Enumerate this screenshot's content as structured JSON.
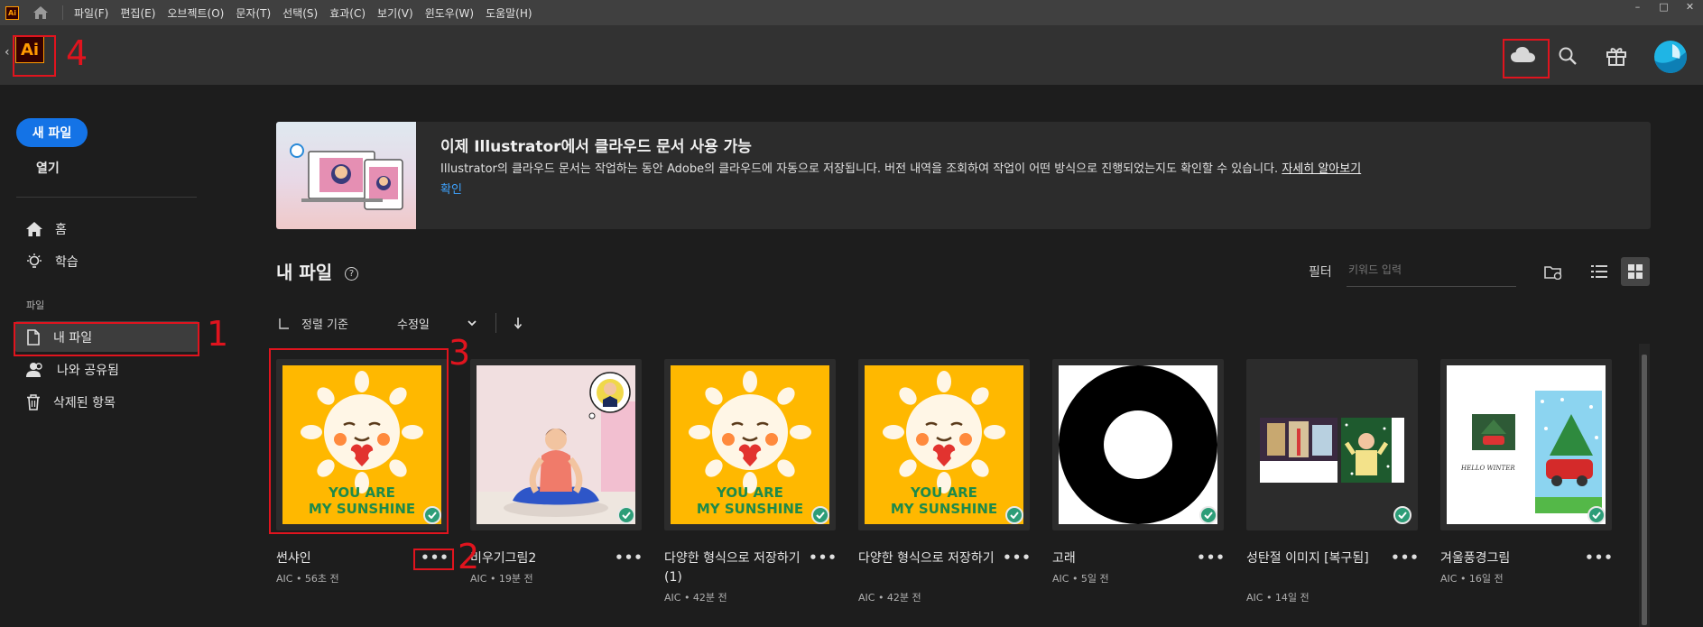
{
  "app": {
    "short_icon_label": "Ai",
    "logo_label": "Ai"
  },
  "menubar": {
    "items": [
      "파일(F)",
      "편집(E)",
      "오브젝트(O)",
      "문자(T)",
      "선택(S)",
      "효과(C)",
      "보기(V)",
      "윈도우(W)",
      "도움말(H)"
    ]
  },
  "window_controls": {
    "minimize": "–",
    "maximize": "□",
    "close": "✕"
  },
  "header": {
    "icons": [
      "cloud-icon",
      "search-icon",
      "gift-icon",
      "avatar"
    ]
  },
  "sidebar": {
    "new_file": "새 파일",
    "open": "열기",
    "nav": [
      {
        "label": "홈",
        "icon": "home-icon"
      },
      {
        "label": "학습",
        "icon": "lightbulb-icon"
      }
    ],
    "section_label": "파일",
    "files_nav": [
      {
        "label": "내 파일",
        "icon": "document-icon"
      },
      {
        "label": "나와 공유됨",
        "icon": "shared-user-icon"
      },
      {
        "label": "삭제된 항목",
        "icon": "trash-icon"
      }
    ]
  },
  "banner": {
    "title": "이제 Illustrator에서 클라우드 문서 사용 가능",
    "body": "Illustrator의 클라우드 문서는 작업하는 동안 Adobe의 클라우드에 자동으로 저장됩니다. 버전 내역을 조회하여 작업이 어떤 방식으로 진행되었는지도 확인할 수 있습니다.",
    "link": "자세히 알아보기",
    "confirm": "확인"
  },
  "files": {
    "title": "내 파일",
    "help": "?",
    "filter_label": "필터",
    "filter_placeholder": "키워드 입력",
    "sort_label": "정렬 기준",
    "sort_value": "수정일",
    "items": [
      {
        "name": "썬샤인",
        "meta": "AIC • 56초 전",
        "thumb": "sunshine",
        "sync": "synced"
      },
      {
        "name": "비우기그림2",
        "meta": "AIC • 19분 전",
        "thumb": "meditation",
        "sync": "synced"
      },
      {
        "name": "다양한 형식으로 저장하기 (1)",
        "meta": "AIC • 42분 전",
        "thumb": "sunshine",
        "sync": "synced"
      },
      {
        "name": "다양한 형식으로 저장하기",
        "meta": "AIC • 42분 전",
        "thumb": "sunshine",
        "sync": "synced"
      },
      {
        "name": "고래",
        "meta": "AIC • 5일 전",
        "thumb": "ring",
        "sync": "synced"
      },
      {
        "name": "성탄절 이미지 [복구됨]",
        "meta": "AIC • 14일 전",
        "thumb": "christmas",
        "sync": "synced"
      },
      {
        "name": "겨울풍경그림",
        "meta": "AIC • 16일 전",
        "thumb": "winter",
        "sync": "synced"
      }
    ],
    "more": "•••",
    "sunshine_text1": "YOU ARE",
    "sunshine_text2": "MY SUNSHINE",
    "winter_text": "HELLO WINTER"
  },
  "annotations": [
    "1",
    "2",
    "3",
    "4"
  ],
  "colors": {
    "accent_blue": "#1473e6",
    "annotation_red": "#e0141e",
    "synced_green": "#2d9d78",
    "thumb_yellow": "#ffb800"
  }
}
